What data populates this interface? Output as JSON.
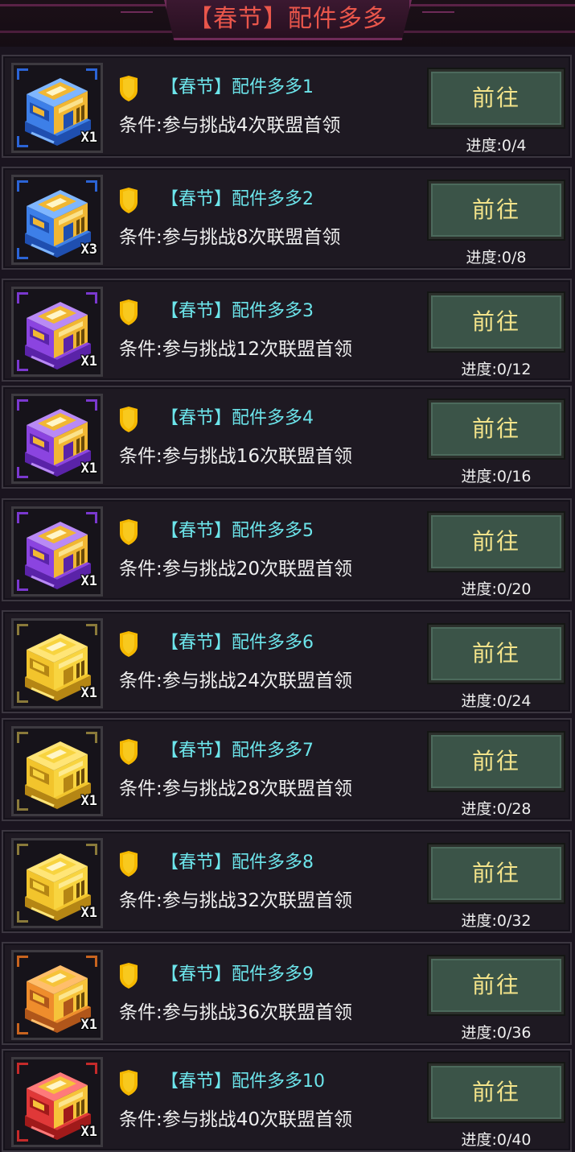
{
  "header": {
    "title": "【春节】配件多多"
  },
  "colors": {
    "title_accent": "#6ce4ea",
    "header_title": "#e9564b",
    "button_text": "#f3e38a",
    "button_fill": "#3b5448",
    "shield": "#f5b800"
  },
  "tasks": [
    {
      "title": "【春节】配件多多1",
      "condition": "条件:参与挑战4次联盟首领",
      "button": "前往",
      "progress": "进度:0/4",
      "qty": "X1",
      "crate_color": "blue",
      "icon": "blue-crate-icon"
    },
    {
      "title": "【春节】配件多多2",
      "condition": "条件:参与挑战8次联盟首领",
      "button": "前往",
      "progress": "进度:0/8",
      "qty": "X3",
      "crate_color": "blue",
      "icon": "blue-crate-icon"
    },
    {
      "title": "【春节】配件多多3",
      "condition": "条件:参与挑战12次联盟首领",
      "button": "前往",
      "progress": "进度:0/12",
      "qty": "X1",
      "crate_color": "purple",
      "icon": "purple-crate-icon"
    },
    {
      "title": "【春节】配件多多4",
      "condition": "条件:参与挑战16次联盟首领",
      "button": "前往",
      "progress": "进度:0/16",
      "qty": "X1",
      "crate_color": "purple",
      "icon": "purple-crate-icon"
    },
    {
      "title": "【春节】配件多多5",
      "condition": "条件:参与挑战20次联盟首领",
      "button": "前往",
      "progress": "进度:0/20",
      "qty": "X1",
      "crate_color": "purple",
      "icon": "purple-crate-icon"
    },
    {
      "title": "【春节】配件多多6",
      "condition": "条件:参与挑战24次联盟首领",
      "button": "前往",
      "progress": "进度:0/24",
      "qty": "X1",
      "crate_color": "gold",
      "icon": "gold-crate-icon"
    },
    {
      "title": "【春节】配件多多7",
      "condition": "条件:参与挑战28次联盟首领",
      "button": "前往",
      "progress": "进度:0/28",
      "qty": "X1",
      "crate_color": "gold",
      "icon": "gold-crate-icon"
    },
    {
      "title": "【春节】配件多多8",
      "condition": "条件:参与挑战32次联盟首领",
      "button": "前往",
      "progress": "进度:0/32",
      "qty": "X1",
      "crate_color": "gold",
      "icon": "gold-crate-icon"
    },
    {
      "title": "【春节】配件多多9",
      "condition": "条件:参与挑战36次联盟首领",
      "button": "前往",
      "progress": "进度:0/36",
      "qty": "X1",
      "crate_color": "orange",
      "icon": "orange-crate-icon"
    },
    {
      "title": "【春节】配件多多10",
      "condition": "条件:参与挑战40次联盟首领",
      "button": "前往",
      "progress": "进度:0/40",
      "qty": "X1",
      "crate_color": "red",
      "icon": "red-crate-icon"
    }
  ]
}
